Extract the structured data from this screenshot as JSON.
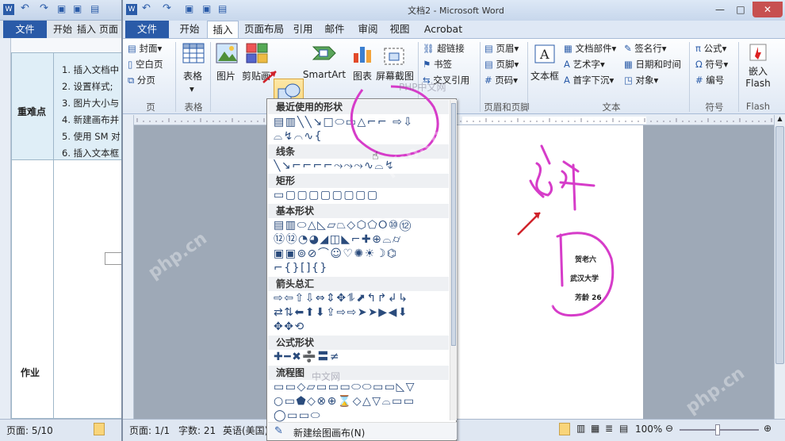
{
  "background_window": {
    "file_tab": "文件",
    "tabs": [
      "开始",
      "插入",
      "页面"
    ],
    "list_items": [
      "1.  插入文档中",
      "2.  设置样式;",
      "3.  图片大小与",
      "4.  新建画布并",
      "5.  使用 SM 对",
      "6.  插入文本框"
    ],
    "row_label_1": "重难点",
    "row_label_2": "作业",
    "status_page": "页面: 5/10"
  },
  "main_window": {
    "title": "文档2 - Microsoft Word",
    "tabs": {
      "file": "文件",
      "home": "开始",
      "insert": "插入",
      "page_layout": "页面布局",
      "references": "引用",
      "mailings": "邮件",
      "review": "审阅",
      "view": "视图",
      "acrobat": "Acrobat"
    },
    "ribbon": {
      "pages": {
        "cover": "封面",
        "blank": "空白页",
        "break": "分页",
        "group": "页"
      },
      "tables": {
        "table": "表格",
        "group": "表格"
      },
      "illustrations": {
        "picture": "图片",
        "clipart": "剪贴画",
        "shapes": "形状",
        "smartart": "SmartArt",
        "chart": "图表",
        "screenshot": "屏幕截图"
      },
      "links": {
        "hyperlink": "超链接",
        "bookmark": "书签",
        "crossref": "交叉引用"
      },
      "header_footer": {
        "header": "页眉",
        "footer": "页脚",
        "page_number": "页码",
        "group": "页眉和页脚"
      },
      "text": {
        "textbox": "文本框",
        "quickparts": "文档部件",
        "wordart": "艺术字",
        "dropcap": "首字下沉",
        "signature": "签名行",
        "datetime": "日期和时间",
        "object": "对象",
        "group": "文本"
      },
      "symbols": {
        "equation": "公式",
        "symbol": "符号",
        "number": "编号",
        "group": "符号"
      },
      "flash": {
        "embed": "嵌入",
        "flash": "Flash",
        "group": "Flash"
      }
    },
    "shapes_menu": {
      "recent": "最近使用的形状",
      "lines": "线条",
      "rectangles": "矩形",
      "basic": "基本形状",
      "arrows": "箭头总汇",
      "equation": "公式形状",
      "flowchart": "流程图",
      "new_canvas": "新建绘图画布(N)",
      "rows": {
        "recent1": "▤▥╲╲↘□⬭▭△⌐⌐ ⇨⇩",
        "recent2": "⌓↯⌒∿{",
        "lines": "╲↘⌐⌐⌐⌐⤳⤳⤳∿⌓↯",
        "rect": "▭▢▢▢▢▢▢▢▢",
        "basic1": "▤▥⬭△◺▱⏢◇⬡⬠⭘⑩⑫",
        "basic2": "⑫⑫◔◕◢◫◣⌐✚⊕⌓⌭",
        "basic3": "▣▣⊚⊘⌒☺♡✺☀☽⌬",
        "basic4": "⌐{}[]{}",
        "arrows1": "⇨⇦⇧⇩⇔⇕✥⥮⬈↰↱↲↳",
        "arrows2": "⇄⇅⬅⬆⬇⇪⇨⇨➤➤▶◀⬇",
        "arrows3": "✥✥⟲",
        "eq": "✚━✖➗〓≠",
        "flow1": "▭▭◇▱▭▭▭⬭⬭▭▭◺▽",
        "flow2": "○▭⬟◇⊗⊕⌛◇△▽⌓▭▭",
        "flow3": "◯▭▭⬭"
      }
    },
    "document": {
      "line1": "贺老六",
      "line2": "武汉大学",
      "line3": "芳龄 26"
    },
    "statusbar": {
      "page": "页面: 1/1",
      "words": "字数: 21",
      "lang": "英语(美国)",
      "zoom": "100%"
    },
    "watermarks": [
      "php.cn",
      "PHP中文网",
      "中文网"
    ],
    "annotation_color": "#d63cc9",
    "arrow_color": "#d0222a",
    "accent_color": "#2a5ba8"
  }
}
